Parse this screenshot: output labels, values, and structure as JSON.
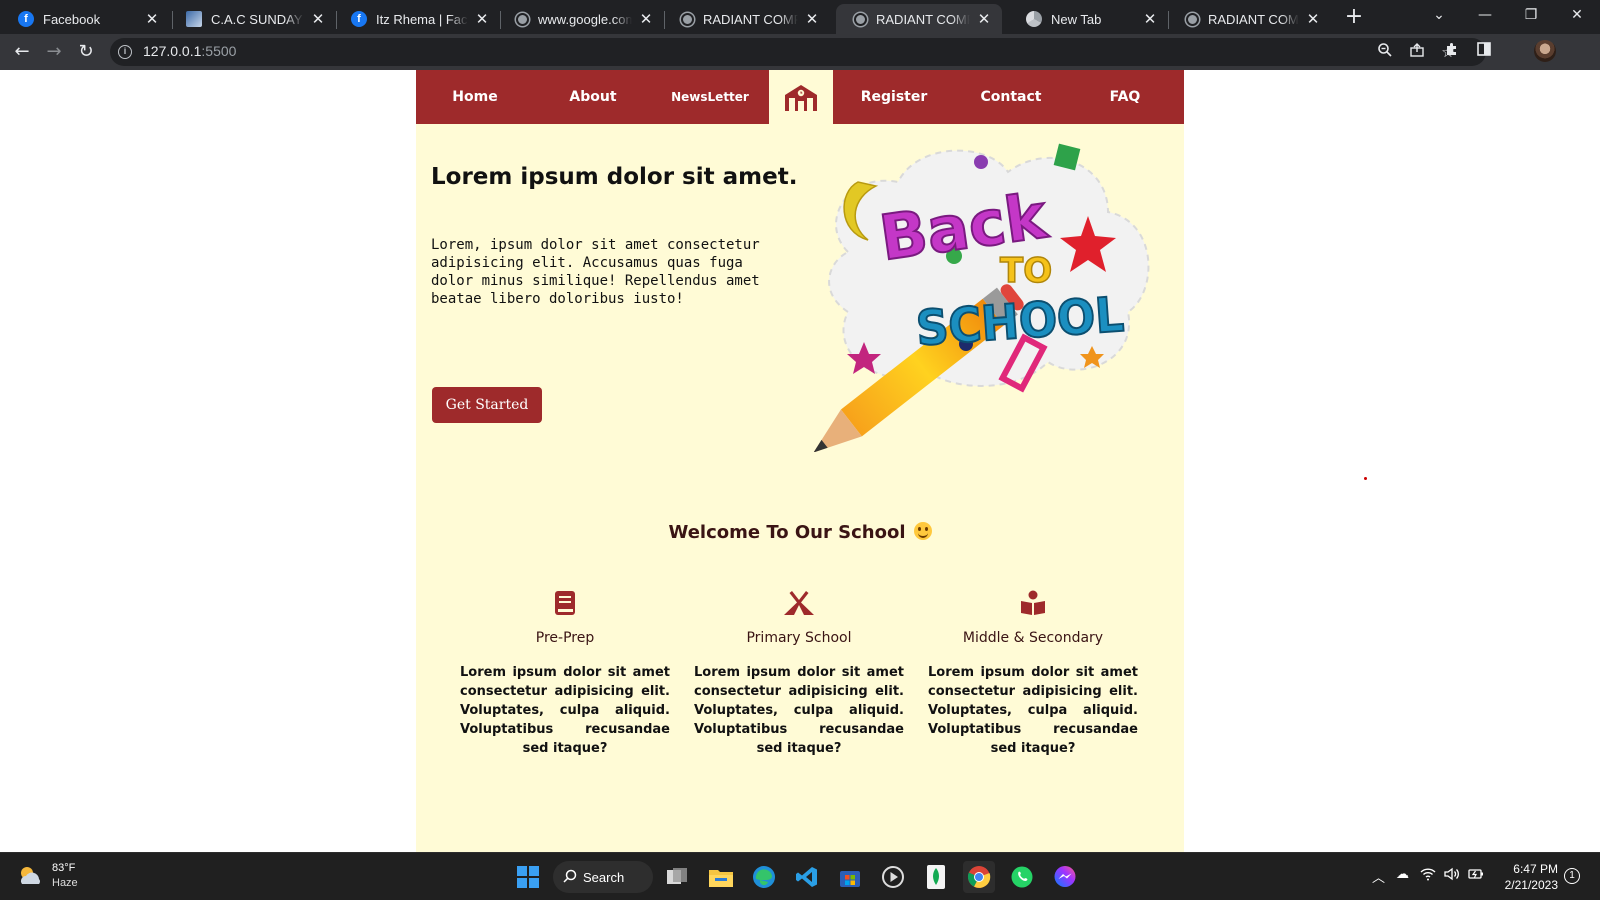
{
  "browser": {
    "tabs": [
      {
        "title": "Facebook",
        "icon": "facebook-icon"
      },
      {
        "title": "C.A.C SUNDAY SCH",
        "icon": "image-favicon"
      },
      {
        "title": "Itz Rhema | Facebo",
        "icon": "facebook-icon"
      },
      {
        "title": "www.google.com",
        "icon": "globe-icon"
      },
      {
        "title": "RADIANT COMPRE",
        "icon": "globe-icon"
      },
      {
        "title": "RADIANT COMPRE",
        "icon": "globe-icon",
        "active": true
      },
      {
        "title": "New Tab",
        "icon": "chrome-icon"
      },
      {
        "title": "RADIANT COMPRE",
        "icon": "globe-icon"
      }
    ],
    "url_host": "127.0.0.1",
    "url_port": ":5500"
  },
  "site": {
    "colors": {
      "primary": "#9e2a2b",
      "background": "#fffbd6"
    },
    "nav": {
      "home": "Home",
      "about": "About",
      "newsletter": "NewsLetter",
      "register": "Register",
      "contact": "Contact",
      "faq": "FAQ"
    },
    "hero": {
      "title": "Lorem ipsum dolor sit amet.",
      "text": "Lorem, ipsum dolor sit amet consectetur adipisicing elit. Accusamus quas fuga dolor minus similique! Repellendus amet beatae libero doloribus iusto!",
      "cta": "Get Started",
      "art": {
        "line1": "Back",
        "line2": "TO",
        "line3": "SCHOOL"
      }
    },
    "welcome": "Welcome To Our School",
    "cards": [
      {
        "icon": "book-icon",
        "title": "Pre-Prep",
        "text": "Lorem ipsum dolor sit amet consectetur adipisicing elit. Voluptates, culpa aliquid. Voluptatibus recusandae sed itaque?"
      },
      {
        "icon": "tent-icon",
        "title": "Primary School",
        "text": "Lorem ipsum dolor sit amet consectetur adipisicing elit. Voluptates, culpa aliquid. Voluptatibus recusandae sed itaque?"
      },
      {
        "icon": "reader-icon",
        "title": "Middle & Secondary",
        "text": "Lorem ipsum dolor sit amet consectetur adipisicing elit. Voluptates, culpa aliquid. Voluptatibus recusandae sed itaque?"
      }
    ]
  },
  "taskbar": {
    "weather_temp": "83°F",
    "weather_cond": "Haze",
    "search_label": "Search",
    "time": "6:47 PM",
    "date": "2/21/2023",
    "notifications": "1"
  }
}
